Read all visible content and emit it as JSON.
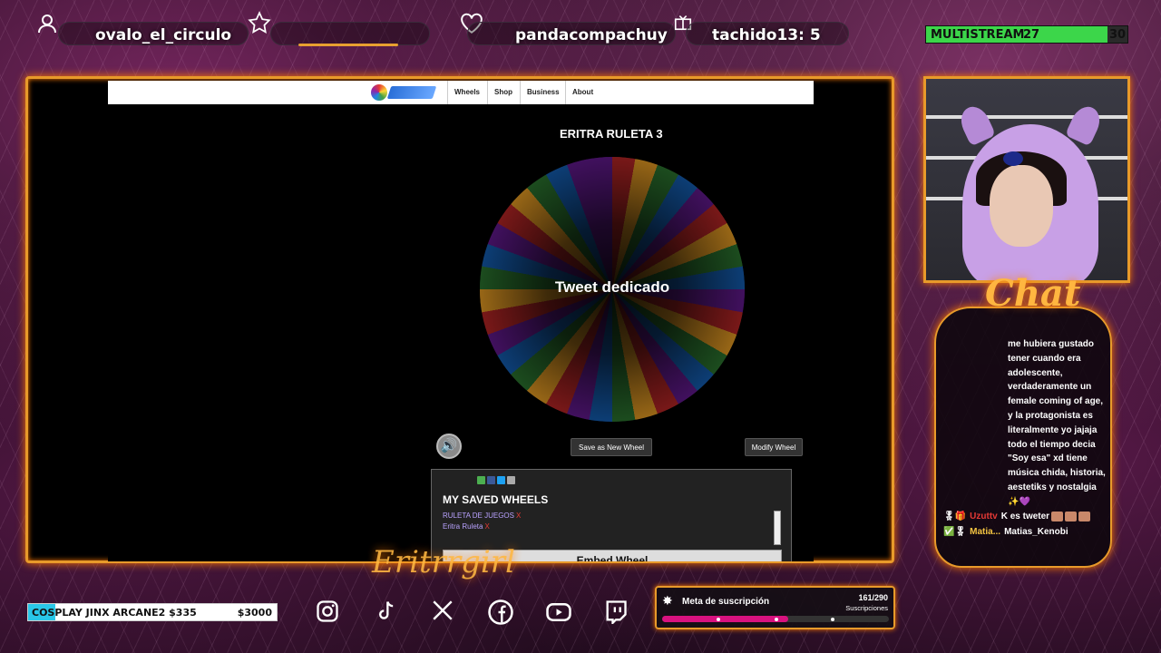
{
  "top_bar": {
    "follower_name": "ovalo_el_circulo",
    "subscriber_name": "pandacompachuy",
    "gifter_text": "tachido13: 5",
    "multistream_label": "MULTISTREAM",
    "multistream_current": "27",
    "multistream_goal": "30",
    "multistream_progress": 0.9
  },
  "website": {
    "nav": {
      "items": [
        "Wheels",
        "Shop",
        "Business",
        "About"
      ]
    },
    "wheel_title": "ERITRA RULETA 3",
    "wheel_center_label": "Tweet dedicado",
    "save_button": "Save as New Wheel",
    "modify_button": "Modify Wheel",
    "saved_title": "MY SAVED WHEELS",
    "saved_items": [
      {
        "label": "RULETA DE JUEGOS",
        "remove": "X"
      },
      {
        "label": "Eritra Ruleta",
        "remove": "X"
      }
    ],
    "embed_button": "Embed Wheel"
  },
  "chat": {
    "title": "Chat",
    "message_text": "me hubiera gustado tener cuando era adolescente, verdaderamente un female coming of age, y la protagonista es literalmente yo jajaja todo el tiempo decia \"Soy esa\" xd tiene música chida, historia, aestetiks y nostalgia ✨💜",
    "lines": [
      {
        "user": "Uzuttv",
        "text": "K es tweter"
      },
      {
        "user": "Matia...",
        "text": "Matias_Kenobi"
      }
    ]
  },
  "bottom": {
    "goal_label": "COSPLAY JINX ARCANE2 $335",
    "goal_target": "$3000",
    "goal_progress": 0.11,
    "sub_goal_label": "Meta de suscripción",
    "sub_goal_count": "161/290",
    "sub_goal_unit": "Suscripciones",
    "sub_goal_progress": 0.555,
    "cursive_text": "Eritrrgirl"
  },
  "colors": {
    "accent": "#e89a2a",
    "multistream": "#3cd64a",
    "goal": "#29c7e8",
    "sub_goal": "#d8127f"
  },
  "icons": [
    "user-icon",
    "star-icon",
    "heart-icon",
    "gift-icon",
    "instagram-icon",
    "tiktok-icon",
    "x-icon",
    "facebook-icon",
    "youtube-icon",
    "twitch-icon",
    "sound-icon",
    "star-badge-icon"
  ]
}
